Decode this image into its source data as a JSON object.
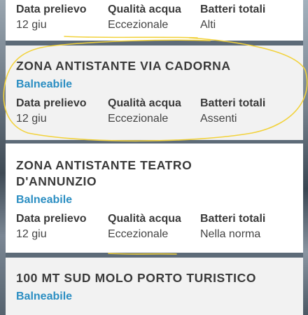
{
  "cards": [
    {
      "title_lines": [],
      "status": "",
      "labels": [
        "Data prelievo",
        "Qualità acqua",
        "Batteri totali"
      ],
      "values": [
        "12 giu",
        "Eccezionale",
        "Alti"
      ]
    },
    {
      "title_lines": [
        "ZONA ANTISTANTE VIA CADORNA"
      ],
      "status": "Balneabile",
      "labels": [
        "Data prelievo",
        "Qualità acqua",
        "Batteri totali"
      ],
      "values": [
        "12 giu",
        "Eccezionale",
        "Assenti"
      ]
    },
    {
      "title_lines": [
        "ZONA ANTISTANTE TEATRO",
        "D'ANNUNZIO"
      ],
      "status": "Balneabile",
      "labels": [
        "Data prelievo",
        "Qualità acqua",
        "Batteri totali"
      ],
      "values": [
        "12 giu",
        "Eccezionale",
        "Nella norma"
      ]
    },
    {
      "title_lines": [
        "100 MT SUD MOLO PORTO TURISTICO"
      ],
      "status": "Balneabile",
      "labels": [],
      "values": []
    }
  ],
  "colors": {
    "title": "#3a3a3a",
    "status": "#2b8ec2",
    "card_bg": "#ffffff",
    "card_bg_alt": "#f2f2f2",
    "highlight": "#f2d23c"
  }
}
